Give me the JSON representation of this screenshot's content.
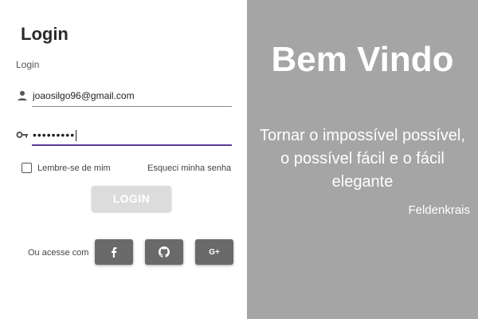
{
  "login_panel": {
    "title": "Login",
    "subtitle": "Login",
    "email": {
      "value": "joaosilgo96@gmail.com",
      "icon": "person-icon"
    },
    "password": {
      "masked_value": "•••••••••",
      "icon": "key-icon"
    },
    "remember_label": "Lembre-se de mim",
    "forgot_label": "Esqueci minha senha",
    "login_button": "LOGIN",
    "social_label": "Ou acesse com",
    "social_buttons": [
      {
        "icon": "facebook-icon"
      },
      {
        "icon": "github-icon"
      },
      {
        "icon": "google-plus-icon",
        "label": "G+"
      }
    ]
  },
  "welcome_panel": {
    "heading": "Bem Vindo",
    "quote": "Tornar o impossível possível, o possível fácil e o fácil elegante",
    "author": "Feldenkrais"
  },
  "colors": {
    "right_panel_bg": "#a5a5a5",
    "social_button_bg": "#6a6a6a",
    "focus_underline": "#5b3a91",
    "login_button_bg": "#dcdcdc"
  }
}
